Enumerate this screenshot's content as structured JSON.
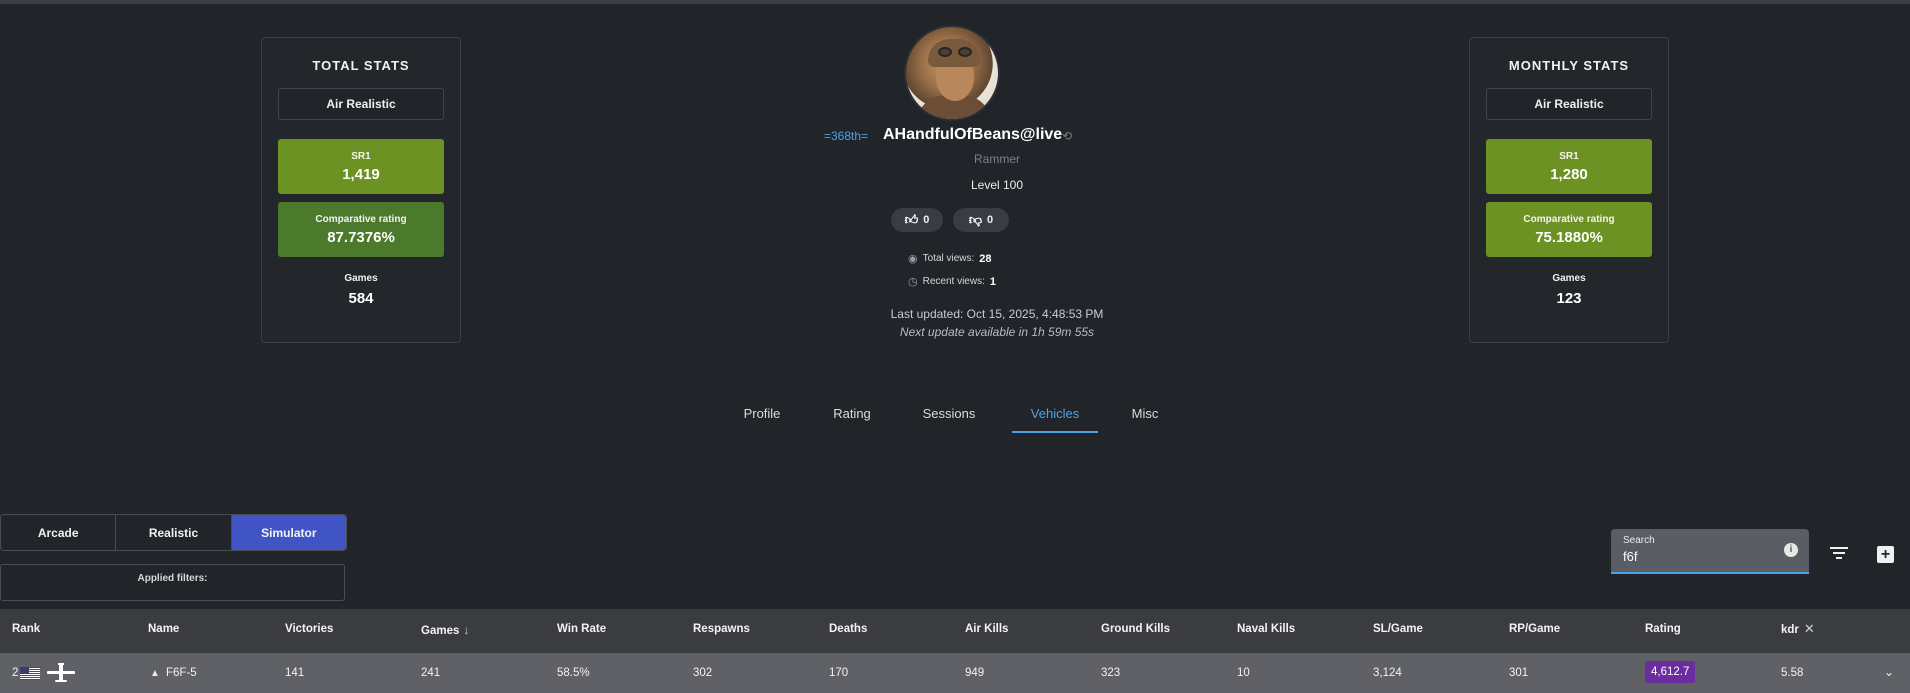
{
  "total_stats": {
    "title": "TOTAL STATS",
    "mode": "Air Realistic",
    "sr1_label": "SR1",
    "sr1_value": "1,419",
    "comp_label": "Comparative rating",
    "comp_value": "87.7376%",
    "games_label": "Games",
    "games_value": "584",
    "sr1_color": "#6b9223",
    "comp_color": "#4c7a2c"
  },
  "monthly_stats": {
    "title": "MONTHLY STATS",
    "mode": "Air Realistic",
    "sr1_label": "SR1",
    "sr1_value": "1,280",
    "comp_label": "Comparative rating",
    "comp_value": "75.1880%",
    "games_label": "Games",
    "games_value": "123",
    "sr1_color": "#6b9223",
    "comp_color": "#6b9223"
  },
  "profile": {
    "clan_tag": "=368th=",
    "name": "AHandfulOfBeans@live",
    "title": "Rammer",
    "level": "Level 100",
    "likes": "0",
    "dislikes": "0",
    "total_views_label": "Total views:",
    "total_views": "28",
    "recent_views_label": "Recent views:",
    "recent_views": "1",
    "last_updated": "Last updated: Oct 15, 2025, 4:48:53 PM",
    "next_update": "Next update available in 1h 59m 55s",
    "icons": [
      "history-icon",
      "thumbs-up-icon",
      "thumbs-down-icon",
      "eye-icon",
      "clock-icon"
    ]
  },
  "tabs": [
    {
      "label": "Profile"
    },
    {
      "label": "Rating"
    },
    {
      "label": "Sessions"
    },
    {
      "label": "Vehicles"
    },
    {
      "label": "Misc"
    }
  ],
  "active_tab": "Vehicles",
  "modes": [
    {
      "label": "Arcade"
    },
    {
      "label": "Realistic"
    },
    {
      "label": "Simulator"
    }
  ],
  "active_mode": "Simulator",
  "applied_filters_label": "Applied filters:",
  "search": {
    "label": "Search",
    "value": "f6f",
    "info_glyph": "i"
  },
  "table": {
    "headers": [
      "Rank",
      "Name",
      "Victories",
      "Games",
      "Win Rate",
      "Respawns",
      "Deaths",
      "Air Kills",
      "Ground Kills",
      "Naval Kills",
      "SL/Game",
      "RP/Game",
      "Rating",
      "kdr"
    ],
    "sorted_column": "Games",
    "rows": [
      {
        "rank": "2",
        "name": "F6F-5",
        "victories": "141",
        "games": "241",
        "win_rate": "58.5%",
        "respawns": "302",
        "deaths": "170",
        "air_kills": "949",
        "ground_kills": "323",
        "naval_kills": "10",
        "sl_game": "3,124",
        "rp_game": "301",
        "rating": "4,612.7",
        "kdr": "5.58",
        "nation": "usa-flag-icon",
        "vehicle_type": "plane-icon"
      }
    ]
  },
  "colors": {
    "background": "#212429",
    "accent": "#4aa3e8",
    "active_mode": "#4154c5",
    "rating_badge": "#6a2c9e"
  }
}
